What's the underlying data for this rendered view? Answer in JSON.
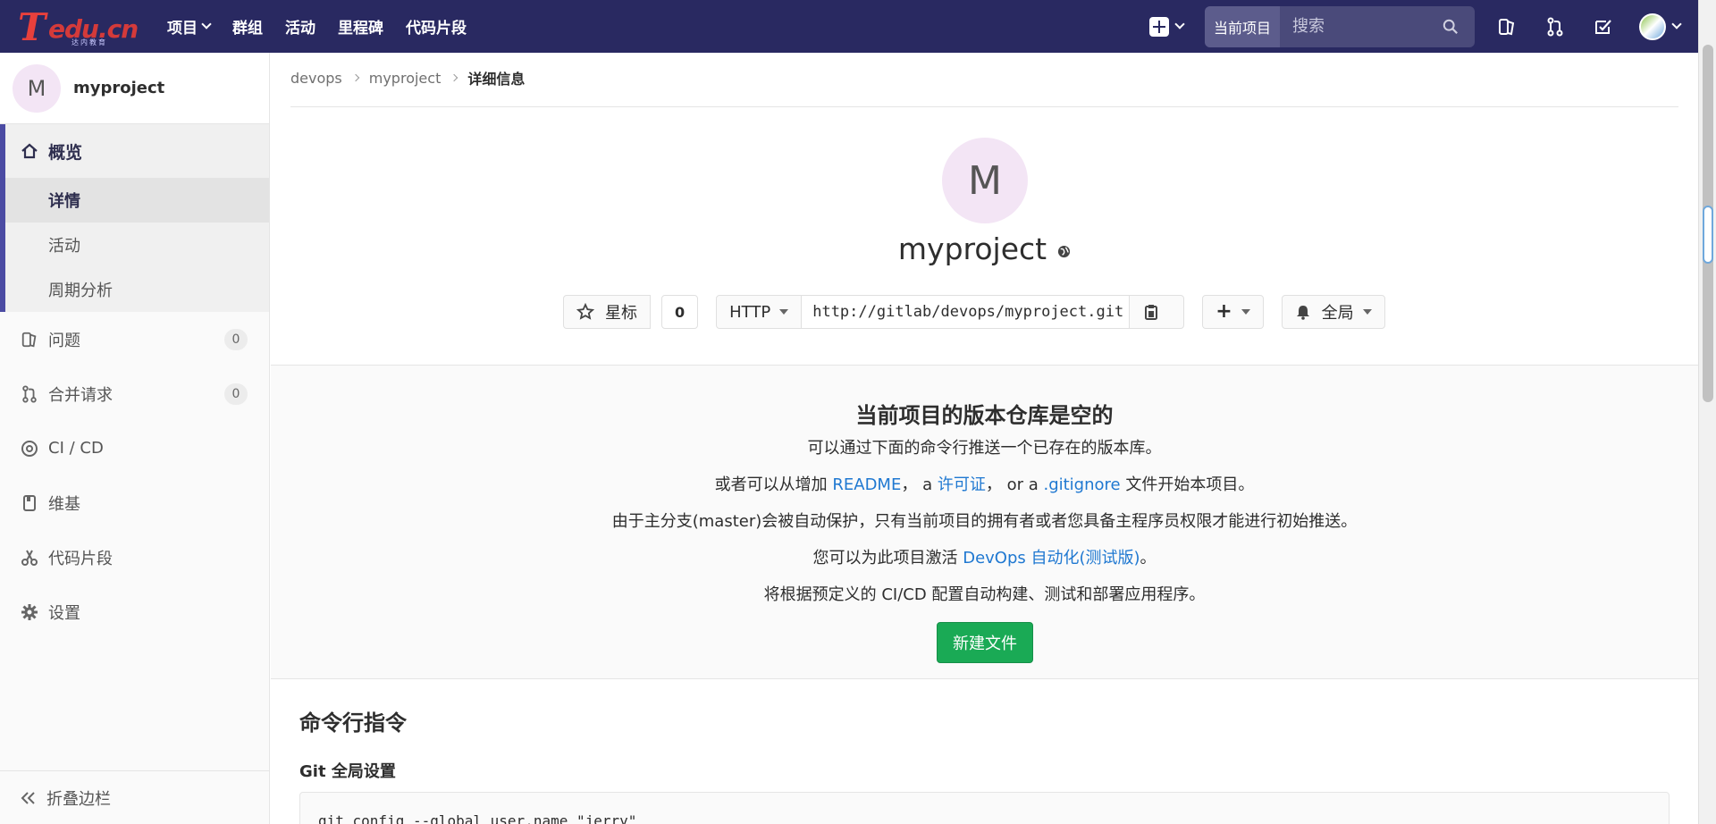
{
  "logo": {
    "t": "T",
    "rest": "edu.cn",
    "sub": "达内教育"
  },
  "nav": {
    "projects": "项目",
    "groups": "群组",
    "activity": "活动",
    "milestones": "里程碑",
    "snippets": "代码片段"
  },
  "search": {
    "scope": "当前项目",
    "placeholder": "搜索"
  },
  "sidebar": {
    "project_initial": "M",
    "project_name": "myproject",
    "overview": "概览",
    "sub_items": [
      "详情",
      "活动",
      "周期分析"
    ],
    "issues": "问题",
    "issues_count": "0",
    "merge_requests": "合并请求",
    "merge_requests_count": "0",
    "cicd": "CI / CD",
    "wiki": "维基",
    "snippets": "代码片段",
    "settings": "设置",
    "collapse": "折叠边栏"
  },
  "breadcrumb": [
    "devops",
    "myproject",
    "详细信息"
  ],
  "project": {
    "initial": "M",
    "name": "myproject",
    "star_label": "星标",
    "star_count": "0",
    "protocol": "HTTP",
    "clone_url": "http://gitlab/devops/myproject.git",
    "notification": "全局"
  },
  "empty_repo": {
    "title": "当前项目的版本仓库是空的",
    "line1": "可以通过下面的命令行推送一个已存在的版本库。",
    "line2_prefix": "或者可以从增加",
    "readme_link": "README",
    "line2_a": "， a",
    "license_link": "许可证",
    "line2_or": "， or a",
    "gitignore_link": ".gitignore",
    "line2_suffix": "文件开始本项目。",
    "line3": "由于主分支(master)会被自动保护，只有当前项目的拥有者或者您具备主程序员权限才能进行初始推送。",
    "line4_prefix": "您可以为此项目激活",
    "devops_link": "DevOps 自动化(测试版)",
    "line4_suffix": "。",
    "line5": "将根据预定义的 CI/CD 配置自动构建、测试和部署应用程序。",
    "new_file": "新建文件"
  },
  "cli": {
    "title": "命令行指令",
    "git_global": "Git 全局设置",
    "code_line1": "git config --global user.name \"jerry\""
  },
  "colors": {
    "navbar": "#292961",
    "accent": "#4b4ba3",
    "success": "#1aaa55",
    "link": "#1f78d1"
  }
}
